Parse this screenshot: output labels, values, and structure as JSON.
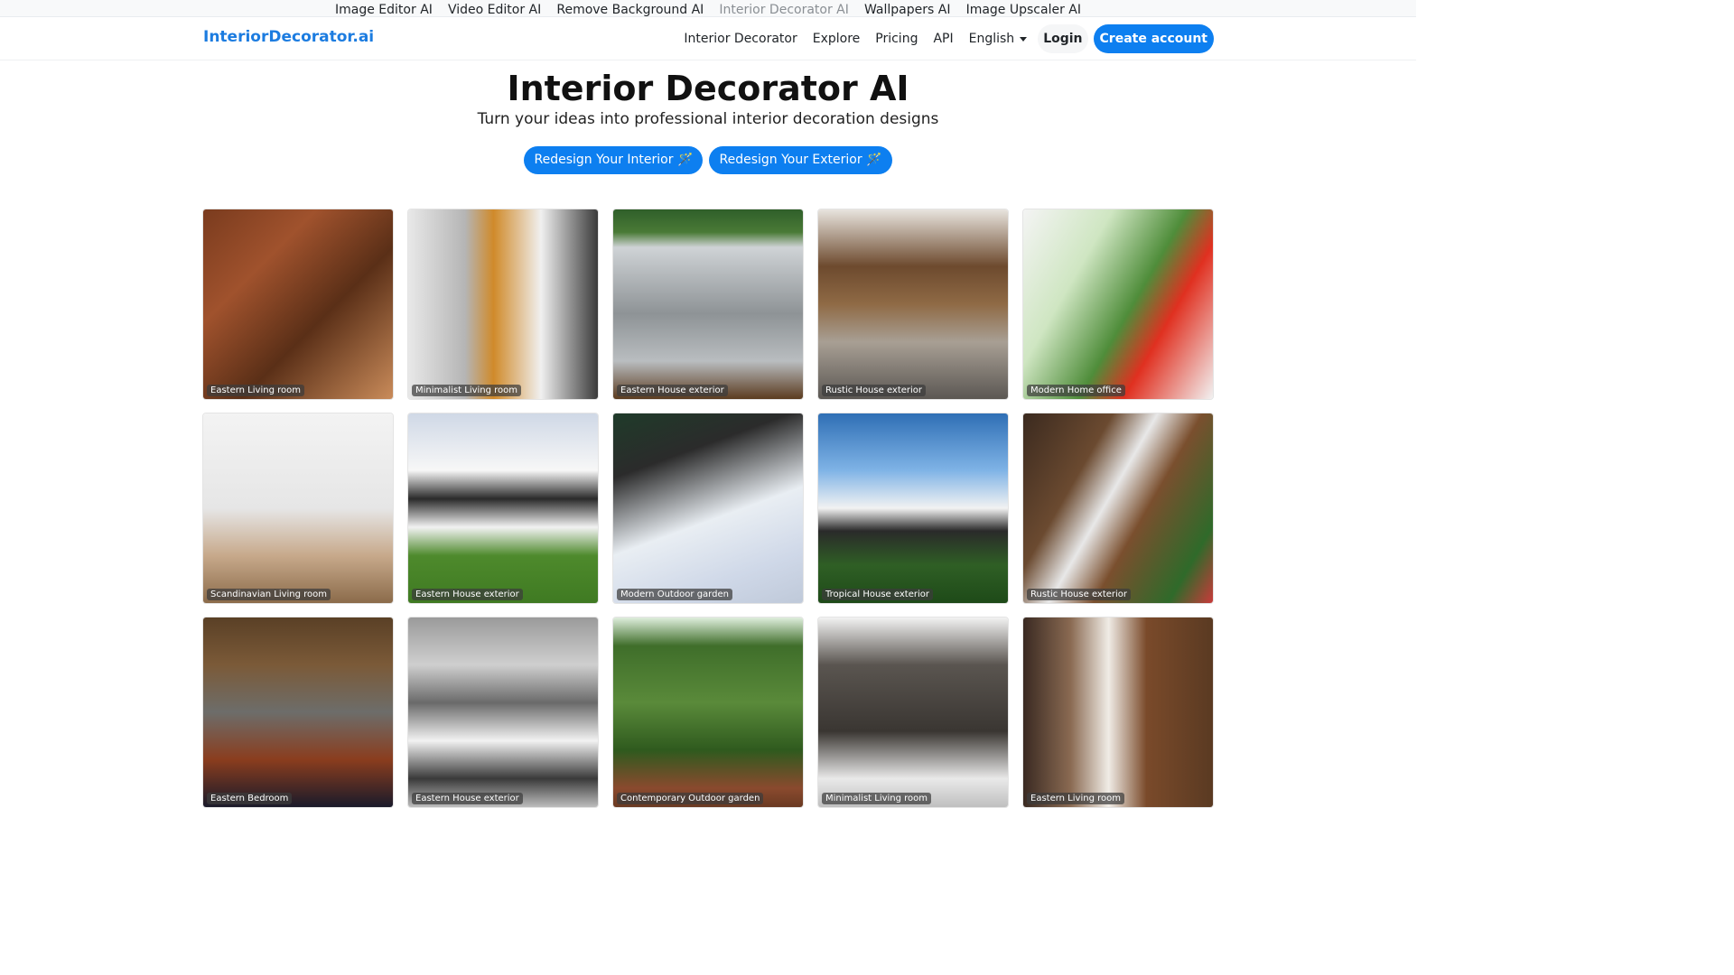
{
  "top_links": [
    {
      "label": "Image Editor AI",
      "active": false
    },
    {
      "label": "Video Editor AI",
      "active": false
    },
    {
      "label": "Remove Background AI",
      "active": false
    },
    {
      "label": "Interior Decorator AI",
      "active": true
    },
    {
      "label": "Wallpapers AI",
      "active": false
    },
    {
      "label": "Image Upscaler AI",
      "active": false
    }
  ],
  "nav": {
    "brand": "InteriorDecorator.ai",
    "links": [
      "Interior Decorator",
      "Explore",
      "Pricing",
      "API"
    ],
    "language": "English",
    "login": "Login",
    "create_account": "Create account"
  },
  "hero": {
    "title": "Interior Decorator AI",
    "subtitle": "Turn your ideas into professional interior decoration designs",
    "buttons": [
      "Redesign Your Interior 🪄",
      "Redesign Your Exterior 🪄"
    ]
  },
  "colors": {
    "primary": "#0d7ff0",
    "brand": "#1c7ce0"
  },
  "gallery": [
    {
      "caption": "Eastern Living room",
      "art": "linear-gradient(135deg,#7a3b1e 0%,#a0522d 30%,#5a2f17 60%,#c98b5a 100%)"
    },
    {
      "caption": "Minimalist Living room",
      "art": "linear-gradient(90deg,#e8e8e8 0%,#b5b5b5 30%,#d08a2a 45%,#f0f0f0 70%,#3a3a3a 100%)"
    },
    {
      "caption": "Eastern House exterior",
      "art": "linear-gradient(180deg,#2f5f2a 0%,#4a7a36 12%,#cfd3d6 20%,#8e9396 55%,#b9bdc0 80%,#5b3b1f 100%)"
    },
    {
      "caption": "Rustic House exterior",
      "art": "linear-gradient(180deg,#e8e4de 0%,#6d4a2e 30%,#8f6a45 50%,#a89f94 70%,#5b5753 100%)"
    },
    {
      "caption": "Modern Home office",
      "art": "linear-gradient(120deg,#f4f4f4 0%,#cfe6c2 30%,#4f8d3a 55%,#e03020 70%,#f2f2f2 100%)"
    },
    {
      "caption": "Scandinavian Living room",
      "art": "linear-gradient(180deg,#f3f3f3 0%,#e6e6e6 50%,#c7a98b 75%,#8b6b4a 100%)"
    },
    {
      "caption": "Eastern House exterior",
      "art": "linear-gradient(180deg,#cfd8e6 0%,#f7f7f7 30%,#2a2a2a 45%,#f2f2f2 60%,#4e8a2c 75%,#3f7a22 100%)"
    },
    {
      "caption": "Modern Outdoor garden",
      "art": "linear-gradient(160deg,#1f3b2a 0%,#2b2b2b 25%,#e9eef3 55%,#cfd8e8 80%,#bfc9d9 100%)"
    },
    {
      "caption": "Tropical House exterior",
      "art": "linear-gradient(180deg,#2f6fb5 0%,#7fb3e6 30%,#f2f2f2 50%,#2a2a2a 62%,#2f5f25 80%,#1e4a18 100%)"
    },
    {
      "caption": "Rustic House exterior",
      "art": "linear-gradient(120deg,#3b2a1f 0%,#6b4a30 30%,#e8e8e8 45%,#7a4f2e 60%,#2f6a2a 85%,#c93a3a 100%)"
    },
    {
      "caption": "Eastern Bedroom",
      "art": "linear-gradient(180deg,#5a4026 0%,#7b5a38 25%,#6d6d6a 50%,#8a3d1e 75%,#1a1a2a 100%)"
    },
    {
      "caption": "Eastern House exterior",
      "art": "linear-gradient(180deg,#9a9a9a 0%,#cfcfcf 25%,#6a6a6a 45%,#f2f2f2 65%,#3a3a3a 85%,#bdbdbd 100%)"
    },
    {
      "caption": "Contemporary Outdoor garden",
      "art": "linear-gradient(180deg,#dfeedd 0%,#3f6e2a 15%,#5a8a3a 45%,#2f5a1e 70%,#8a4a2e 90%,#6a3a22 100%)"
    },
    {
      "caption": "Minimalist Living room",
      "art": "linear-gradient(180deg,#f2f2f2 0%,#5a5550 25%,#3a3632 60%,#e9e9e9 85%,#bfbfbf 100%)"
    },
    {
      "caption": "Eastern Living room",
      "art": "linear-gradient(90deg,#3a2a22 0%,#8a6a52 25%,#f0ece6 45%,#7a4a2a 65%,#5a3a22 100%)"
    }
  ]
}
